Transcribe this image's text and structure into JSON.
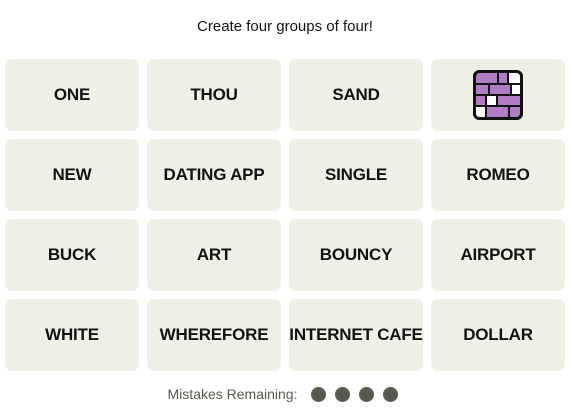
{
  "instructions": "Create four groups of four!",
  "tiles": [
    {
      "label": "ONE"
    },
    {
      "label": "THOU"
    },
    {
      "label": "SAND"
    },
    {
      "label": "",
      "icon": "purple-brick-grid-icon"
    },
    {
      "label": "NEW"
    },
    {
      "label": "DATING APP"
    },
    {
      "label": "SINGLE"
    },
    {
      "label": "ROMEO"
    },
    {
      "label": "BUCK"
    },
    {
      "label": "ART"
    },
    {
      "label": "BOUNCY"
    },
    {
      "label": "AIRPORT"
    },
    {
      "label": "WHITE"
    },
    {
      "label": "WHEREFORE"
    },
    {
      "label": "INTERNET CAFE"
    },
    {
      "label": "DOLLAR"
    }
  ],
  "mistakes": {
    "label": "Mistakes Remaining:",
    "remaining": 4
  },
  "colors": {
    "tile_background": "#efefe6",
    "tile_text": "#121212",
    "dot": "#5a594e",
    "icon_purple": "#b07cc4"
  }
}
